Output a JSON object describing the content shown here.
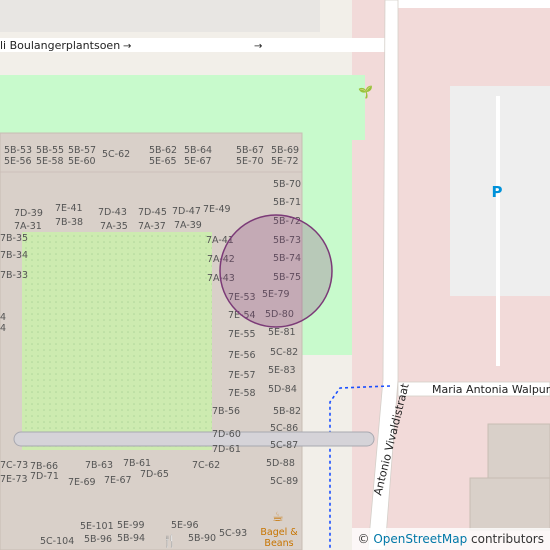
{
  "map": {
    "street_names": {
      "top": "li Boulangerplantsoen",
      "east_vertical": "Antonio Vivaldistraat",
      "east_horizontal": "Maria Antonia Walpurg"
    },
    "parking_label": "P",
    "poi": {
      "name": "Bagel & Beans",
      "name_line1": "Bagel &",
      "name_line2": "Beans"
    },
    "unit_labels": [
      "5B-53",
      "5B-55",
      "5B-57",
      "5E-56",
      "5E-58",
      "5E-60",
      "5C-62",
      "5B-62",
      "5B-64",
      "5E-65",
      "5E-67",
      "5B-67",
      "5B-69",
      "5E-70",
      "5E-72",
      "5B-70",
      "5B-71",
      "5B-72",
      "5B-73",
      "5B-74",
      "5B-75",
      "5E-79",
      "5D-80",
      "5E-81",
      "5C-82",
      "5E-83",
      "5D-84",
      "5B-82",
      "5C-86",
      "5C-87",
      "5D-88",
      "5C-89",
      "5C-93",
      "5E-96",
      "5B-90",
      "5E-99",
      "5B-94",
      "5E-101",
      "5B-96",
      "5C-104",
      "7E-41",
      "7B-38",
      "7D-39",
      "7A-31",
      "7B-35",
      "7B-34",
      "7B-33",
      "7D-43",
      "7A-35",
      "7D-45",
      "7A-37",
      "7D-47",
      "7A-39",
      "7E-49",
      "7A-41",
      "7A-42",
      "7A-43",
      "7E-53",
      "7E-54",
      "7E-55",
      "7E-56",
      "7E-57",
      "7E-58",
      "7B-56",
      "7D-60",
      "7D-61",
      "7C-62",
      "7B-61",
      "7D-65",
      "7B-63",
      "7E-67",
      "7E-69",
      "7B-66",
      "7D-71",
      "7C-73",
      "7E-73"
    ],
    "attribution_symbol": "©",
    "attribution_link": "OpenStreetMap",
    "attribution_suffix": "contributors"
  }
}
